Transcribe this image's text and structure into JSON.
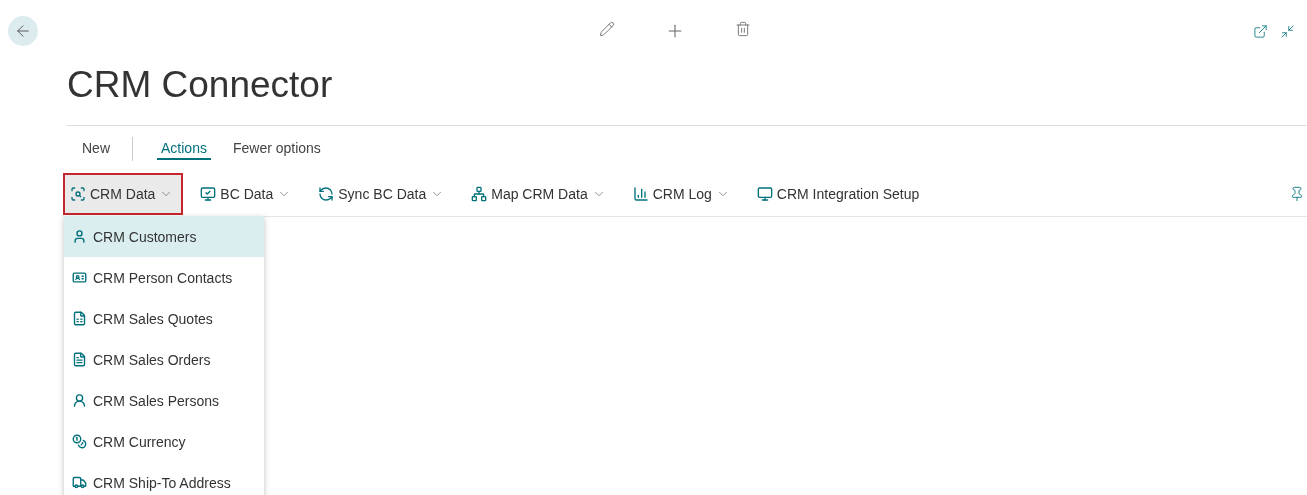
{
  "page": {
    "title": "CRM Connector"
  },
  "tabs": [
    {
      "label": "New",
      "selected": false
    },
    {
      "label": "Actions",
      "selected": true
    },
    {
      "label": "Fewer options",
      "selected": false
    }
  ],
  "actions": [
    {
      "label": "CRM Data",
      "dropdown": true,
      "open": true
    },
    {
      "label": "BC Data",
      "dropdown": true,
      "open": false
    },
    {
      "label": "Sync BC Data",
      "dropdown": true,
      "open": false
    },
    {
      "label": "Map CRM Data",
      "dropdown": true,
      "open": false
    },
    {
      "label": "CRM Log",
      "dropdown": true,
      "open": false
    },
    {
      "label": "CRM Integration Setup",
      "dropdown": false,
      "open": false
    }
  ],
  "menu": [
    {
      "label": "CRM Customers",
      "selected": true
    },
    {
      "label": "CRM Person Contacts",
      "selected": false
    },
    {
      "label": "CRM Sales Quotes",
      "selected": false
    },
    {
      "label": "CRM Sales Orders",
      "selected": false
    },
    {
      "label": "CRM Sales Persons",
      "selected": false
    },
    {
      "label": "CRM Currency",
      "selected": false
    },
    {
      "label": "CRM Ship-To Address",
      "selected": false
    }
  ]
}
